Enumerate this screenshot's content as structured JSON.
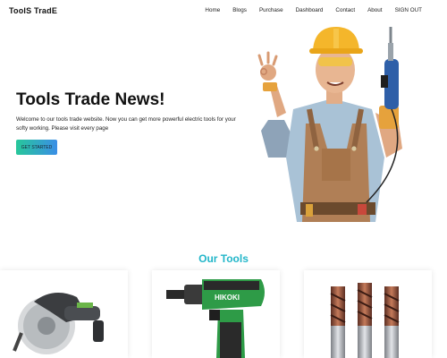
{
  "brand": "ToolS TradE",
  "nav": {
    "home": "Home",
    "blogs": "Blogs",
    "purchase": "Purchase",
    "dashboard": "Dashboard",
    "contact": "Contact",
    "about": "About",
    "signout": "SIGN OUT"
  },
  "hero": {
    "title": "Tools Trade News!",
    "text": "Welcome to our tools trade website. Now you can get more powerful electric tools for your softy working. Please visit every page",
    "cta": "GET STARTED",
    "drill_brand": "HIKOKI"
  },
  "tools_section": {
    "title": "Our Tools",
    "items": [
      {
        "icon": "circular-saw-icon"
      },
      {
        "icon": "impact-drill-icon"
      },
      {
        "icon": "end-mill-bits-icon"
      }
    ]
  },
  "colors": {
    "accent": "#22b6c9",
    "cta_start": "#27c79a",
    "cta_end": "#3a8ee6",
    "drill_green": "#2e9b47"
  }
}
